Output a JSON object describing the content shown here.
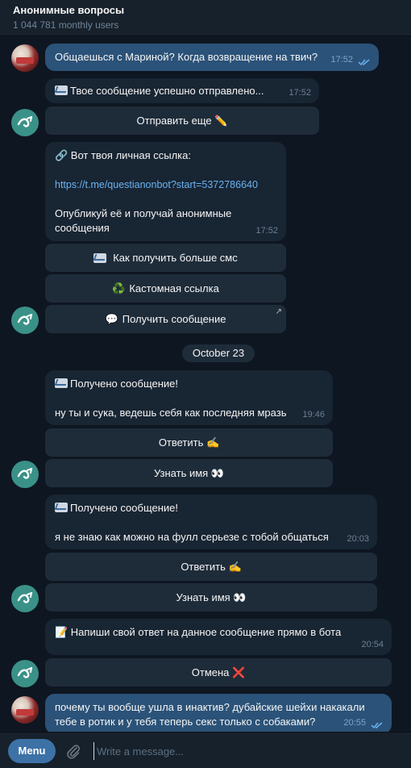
{
  "header": {
    "title": "Анонимные вопросы",
    "subtitle": "1 044 781 monthly users"
  },
  "messages": {
    "m1": {
      "text": "Общаешься с Мариной? Когда возвращение на твич?",
      "time": "17:52"
    },
    "m2": {
      "text": "Твое сообщение успешно отправлено...",
      "time": "17:52",
      "button": "Отправить еще ✏️"
    },
    "m3": {
      "line1": "🔗 Вот твоя личная ссылка:",
      "link": "https://t.me/questianonbot?start=5372786640",
      "line2": "Опубликуй её и получай анонимные",
      "line3": "сообщения",
      "time": "17:52",
      "buttons": [
        "Как получить больше смс",
        "Кастомная ссылка",
        "Получить сообщение"
      ],
      "button_emojis": [
        "♻️",
        "💬"
      ]
    },
    "date_separator": "October 23",
    "m4": {
      "title": "Получено сообщение!",
      "text": "ну ты и сука, ведешь себя как последняя мразь",
      "time": "19:46",
      "buttons": [
        "Ответить ✍️",
        "Узнать имя 👀"
      ]
    },
    "m5": {
      "title": "Получено сообщение!",
      "text": "я не знаю как можно на фулл серьезе с тобой общаться",
      "time": "20:03",
      "buttons": [
        "Ответить ✍️",
        "Узнать имя 👀"
      ]
    },
    "m6": {
      "text": "📝 Напиши свой ответ на данное сообщение прямо в бота",
      "time": "20:54",
      "button": "Отмена ❌"
    },
    "m7": {
      "line1": "почему ты вообще ушла в инактив? дубайские шейхи накакали",
      "line2": "тебе в ротик и у тебя теперь секс только с собаками?",
      "time": "20:55"
    }
  },
  "composer": {
    "menu_label": "Menu",
    "placeholder": "Write a message..."
  },
  "icons": {
    "attach": "paperclip-icon",
    "read_receipt": "double-check-icon",
    "envelope": "envelope-icon",
    "external": "arrow-up-right-icon"
  },
  "colors": {
    "background": "#0e1621",
    "incoming_bubble": "#182533",
    "outgoing_bubble": "#2b5278",
    "bot_avatar": "#3a9188",
    "link": "#6ab3f3",
    "menu_button": "#3d72a6"
  }
}
